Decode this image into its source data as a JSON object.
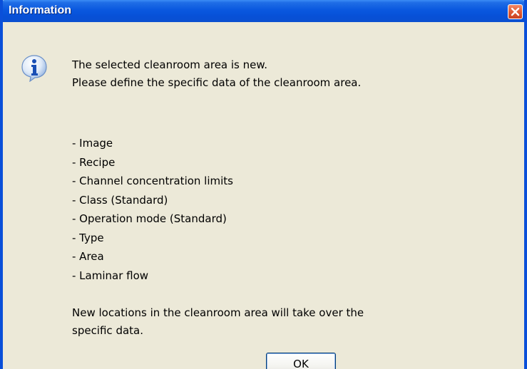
{
  "window": {
    "title": "Information",
    "title_color": "#0a58df"
  },
  "message": {
    "line1": "The selected cleanroom area is new.",
    "line2": "Please define the specific data of the cleanroom area."
  },
  "items": [
    "- Image",
    "- Recipe",
    "- Channel concentration limits",
    "- Class (Standard)",
    "- Operation mode (Standard)",
    "- Type",
    "- Area",
    "- Laminar flow"
  ],
  "footer": {
    "line1": "New locations in the cleanroom area will take over the",
    "line2": "specific data."
  },
  "buttons": {
    "ok_label": "OK"
  },
  "icons": {
    "info": "info-icon",
    "close": "close-icon"
  }
}
